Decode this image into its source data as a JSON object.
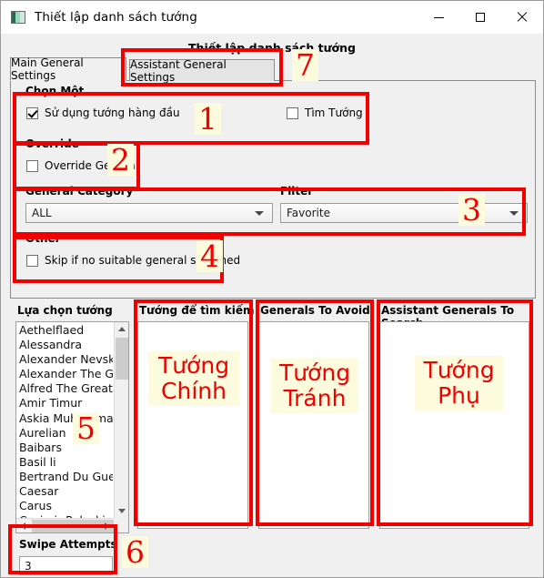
{
  "window": {
    "title": "Thiết lập danh sách tướng",
    "icon": "app-icon",
    "minimize": "—",
    "maximize": "□",
    "close": "✕"
  },
  "header": {
    "title": "Thiết lập danh sách tướng"
  },
  "tabs": [
    {
      "label": "Main General Settings",
      "active": true
    },
    {
      "label": "Assistant General Settings",
      "active": false
    }
  ],
  "groups": {
    "chon_mot": {
      "title": "Chọn Một",
      "checkbox_primary": {
        "label": "Sử dụng tướng hàng đầu",
        "checked": true
      },
      "checkbox_secondary": {
        "label": "Tìm Tướng",
        "checked": false
      }
    },
    "override": {
      "title": "Override",
      "checkbox": {
        "label": "Override General",
        "checked": false
      }
    },
    "category": {
      "general_category_label": "General Category",
      "general_category_value": "ALL",
      "filter_label": "Filter",
      "filter_value": "Favorite"
    },
    "other": {
      "title": "Other",
      "checkbox": {
        "label": "Skip if no suitable general searched",
        "checked": false
      }
    }
  },
  "lists": {
    "available": {
      "label": "Lựa chọn tướng",
      "items": [
        "Aethelflaed",
        "Alessandra",
        "Alexander Nevsky",
        "Alexander The Great",
        "Alfred The Great",
        "Amir Timur",
        "Askia Muhammad I",
        "Aurelian",
        "Baibars",
        "Basil li",
        "Bertrand Du Guesclin",
        "Caesar",
        "Carus",
        "Casimir Pulaski"
      ]
    },
    "to_search": {
      "label": "Tướng để tìm kiếm",
      "items": []
    },
    "to_avoid": {
      "label": "Generals To Avoid",
      "items": []
    },
    "assistant": {
      "label": "Assistant Generals To Search",
      "items": []
    }
  },
  "swipe": {
    "label": "Swipe Attempts",
    "value": "3"
  },
  "annotations": {
    "n1": "1",
    "n2": "2",
    "n3": "3",
    "n4": "4",
    "n5": "5",
    "n6": "6",
    "n7": "7",
    "t_main": "Tướng\nChính",
    "t_avoid": "Tướng\nTránh",
    "t_assist": "Tướng\nPhụ",
    "color": "#f20000",
    "highlight": "#fdfbdd"
  }
}
